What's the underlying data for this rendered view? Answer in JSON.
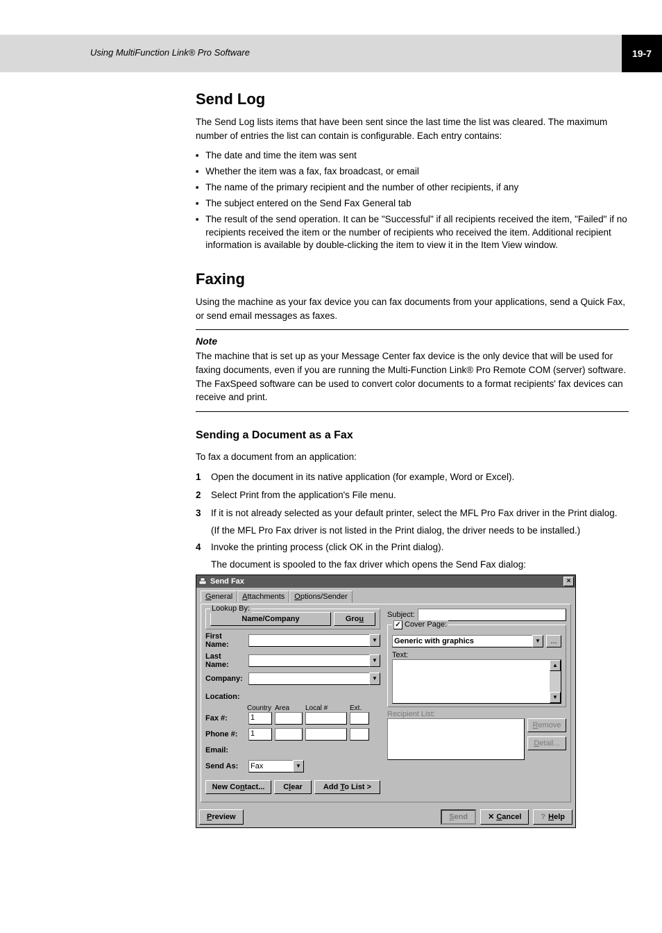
{
  "header": {
    "breadcrumb": "Using MultiFunction Link® Pro Software",
    "page_number": "19-7"
  },
  "section1": {
    "heading": "Send Log",
    "para": "The Send Log lists items that have been sent since the last time the list was cleared. The maximum number of entries the list can contain is configurable. Each entry contains:",
    "bullets": [
      "The date and time the item was sent",
      "Whether the item was a fax, fax broadcast, or email",
      "The name of the primary recipient and the number of other recipients, if any",
      "The subject entered on the Send Fax General tab",
      "The result of the send operation. It can be \"Successful\" if all recipients received the item, \"Failed\" if no recipients received the item or the number of recipients who received the item. Additional recipient information is available by double-clicking the item to view it in the Item View window."
    ]
  },
  "section2": {
    "heading": "Faxing",
    "para": "Using the machine as your fax device you can fax documents from your applications, send a Quick Fax, or send email messages as faxes.",
    "note_label": "Note",
    "note_text": "The machine that is set up as your Message Center fax device is the only device that will be used for faxing documents, even if you are running the Multi-Function Link® Pro Remote COM (server) software. The FaxSpeed software can be used to convert color documents to a format recipients' fax devices can receive and print."
  },
  "section3": {
    "heading": "Sending a Document as a Fax",
    "intro": "To fax a document from an application:",
    "steps": [
      {
        "n": "1",
        "t": "Open the document in its native application (for example, Word or Excel)."
      },
      {
        "n": "2",
        "t": "Select Print from the application's File menu."
      },
      {
        "n": "3",
        "t": "If it is not already selected as your default printer, select the MFL Pro Fax driver in the Print dialog.",
        "sub": "(If the MFL Pro Fax driver is not listed in the Print dialog, the driver needs to be installed.)"
      },
      {
        "n": "4",
        "t": "Invoke the printing process (click OK in the Print dialog).",
        "sub": "The document is spooled to the fax driver which opens the Send Fax dialog:"
      }
    ]
  },
  "dialog": {
    "title": "Send Fax",
    "close_glyph": "×",
    "tabs": [
      {
        "u": "G",
        "r": "eneral"
      },
      {
        "u": "A",
        "r": "ttachments"
      },
      {
        "u": "O",
        "r": "ptions/Sender"
      }
    ],
    "lookup_by_label": "Lookup By:",
    "lookup_buttons": [
      "Name/Company",
      {
        "pre": "Gro",
        "u": "u",
        "post": "p"
      }
    ],
    "fields": {
      "first_name": "First Name:",
      "last_name": "Last Name:",
      "company": "Company:",
      "location": "Location:",
      "fax": "Fax #:",
      "phone": "Phone #:",
      "email": "Email:",
      "send_as": "Send As:"
    },
    "phone_cols": [
      "Country",
      "Area",
      "Local #",
      "Ext."
    ],
    "fax_country": "1",
    "phone_country": "1",
    "send_as_value": "Fax",
    "bottom_btns": [
      {
        "pre": "New Co",
        "u": "n",
        "post": "tact..."
      },
      {
        "pre": "C",
        "u": "l",
        "post": "ear"
      },
      {
        "pre": "Add ",
        "u": "T",
        "post": "o List >"
      }
    ],
    "subject_label": "Subject:",
    "cover_page_label": "Cover Page:",
    "cover_template": "Generic with graphics",
    "browse_btn": "...",
    "text_label": "Text:",
    "recipient_list_label": "Recipient List:",
    "side_btns": [
      {
        "u": "R",
        "r": "emove"
      },
      {
        "u": "D",
        "r": "etail..."
      }
    ],
    "footer": {
      "preview": {
        "u": "P",
        "r": "review"
      },
      "send": {
        "u": "S",
        "r": "end"
      },
      "cancel": {
        "u": "C",
        "r": "ancel"
      },
      "help": {
        "u": "H",
        "r": "elp"
      }
    }
  }
}
